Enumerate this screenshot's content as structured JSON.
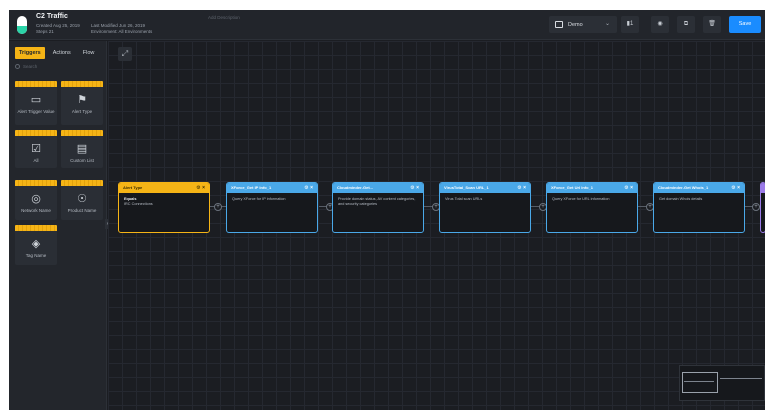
{
  "workflow": {
    "title": "C2 Traffic",
    "created": "Created Aug 25, 2019",
    "steps": "Steps 21",
    "last_modified": "Last Modified Jun 26, 2019",
    "environment": "Environment: All Environments",
    "description_placeholder": "Add Description"
  },
  "toolbar": {
    "environment_value": "Demo",
    "count_label": "1",
    "save_label": "Save",
    "accent_color": "#1a8cff"
  },
  "sidebar": {
    "tabs": [
      {
        "label": "Triggers",
        "active": true
      },
      {
        "label": "Actions",
        "active": false
      },
      {
        "label": "Flow",
        "active": false
      }
    ],
    "search_placeholder": "Search",
    "tiles": [
      {
        "label": "Alert Trigger Value",
        "icon": "alert-trigger-icon"
      },
      {
        "label": "Alert Type",
        "icon": "flag-icon"
      },
      {
        "label": "All",
        "icon": "checkbox-icon"
      },
      {
        "label": "Custom List",
        "icon": "list-icon"
      },
      {
        "label": "Network Name",
        "icon": "globe-icon"
      },
      {
        "label": "Product Name",
        "icon": "compass-icon"
      },
      {
        "label": "Tag Name",
        "icon": "tag-icon"
      }
    ],
    "trigger_color": "#f5b416"
  },
  "nodes": [
    {
      "title": "Alert Type",
      "subtitle": "Equals",
      "body": "IRC Connections",
      "kind": "trigger"
    },
    {
      "title": "XForce_Get IP Info_1",
      "subtitle": "",
      "body": "Query XForce for IP information",
      "kind": "action"
    },
    {
      "title": "Cloudminder-Get...",
      "subtitle": "",
      "body": "Provide domain status, AV content categories, and security categories",
      "kind": "action"
    },
    {
      "title": "VirusTotal_Scan URL_1",
      "subtitle": "",
      "body": "Virus Total scan URLs",
      "kind": "action"
    },
    {
      "title": "XForce_Get Url Info_1",
      "subtitle": "",
      "body": "Query XForce for URL information",
      "kind": "action"
    },
    {
      "title": "Cloudminder-Get Whois_1",
      "subtitle": "",
      "body": "Get domain Whois details",
      "kind": "action"
    }
  ]
}
